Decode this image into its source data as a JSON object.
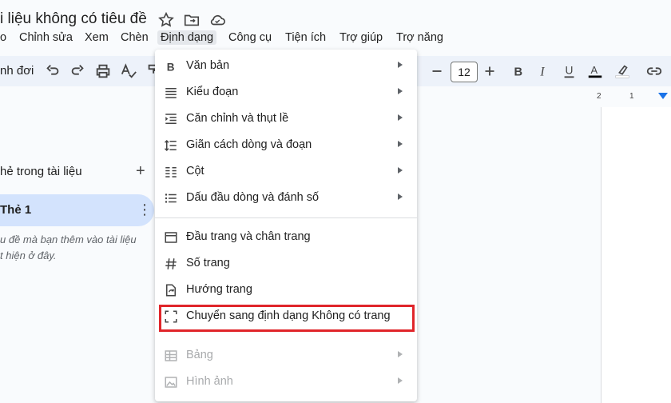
{
  "document": {
    "title": "i liệu không có tiêu đề"
  },
  "menubar": [
    {
      "label": "o"
    },
    {
      "label": "Chỉnh sửa"
    },
    {
      "label": "Xem"
    },
    {
      "label": "Chèn"
    },
    {
      "label": "Định dạng"
    },
    {
      "label": "Công cụ"
    },
    {
      "label": "Tiện ích"
    },
    {
      "label": "Trợ giúp"
    },
    {
      "label": "Trợ năng"
    }
  ],
  "toolbar": {
    "search_partial": "nh đơi",
    "font_size": "12",
    "minus": "−",
    "plus": "+"
  },
  "ruler": {
    "marks": [
      "2",
      "1"
    ]
  },
  "tabs_panel": {
    "header": "hẻ trong tài liệu",
    "add": "+",
    "selected_tab": "Thẻ 1",
    "more": "⋮",
    "hint_line1": "u đề mà bạn thêm vào tài liệu",
    "hint_line2": "t hiện ở đây."
  },
  "format_menu": {
    "items": [
      {
        "label": "Văn bản",
        "icon": "bold-icon",
        "submenu": true,
        "enabled": true
      },
      {
        "label": "Kiểu đoạn",
        "icon": "paragraph-style-icon",
        "submenu": true,
        "enabled": true
      },
      {
        "label": "Căn chỉnh và thụt lề",
        "icon": "indent-icon",
        "submenu": true,
        "enabled": true
      },
      {
        "label": "Giãn cách dòng và đoạn",
        "icon": "line-spacing-icon",
        "submenu": true,
        "enabled": true
      },
      {
        "label": "Cột",
        "icon": "columns-icon",
        "submenu": true,
        "enabled": true
      },
      {
        "label": "Dấu đầu dòng và đánh số",
        "icon": "bulleted-list-icon",
        "submenu": true,
        "enabled": true
      },
      {
        "label": "Đầu trang và chân trang",
        "icon": "header-footer-icon",
        "submenu": false,
        "enabled": true
      },
      {
        "label": "Số trang",
        "icon": "hash-icon",
        "submenu": false,
        "enabled": true
      },
      {
        "label": "Hướng trang",
        "icon": "page-orientation-icon",
        "submenu": false,
        "enabled": true
      },
      {
        "label": "Chuyển sang định dạng Không có trang",
        "icon": "pageless-icon",
        "submenu": false,
        "enabled": true,
        "highlighted": true
      },
      {
        "label": "Bảng",
        "icon": "table-icon",
        "submenu": true,
        "enabled": false
      },
      {
        "label": "Hình ảnh",
        "icon": "image-icon",
        "submenu": true,
        "enabled": false
      }
    ]
  },
  "colors": {
    "highlight_border": "#e0252a",
    "toolbar_bg": "#edf2fa",
    "selected_tab_bg": "#d3e3fd"
  }
}
